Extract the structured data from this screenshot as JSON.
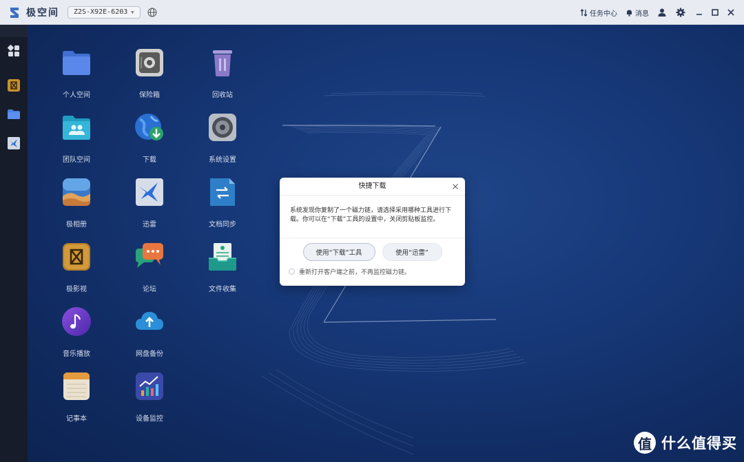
{
  "titlebar": {
    "brand": "极空间",
    "device": "Z2S-X92E-6203",
    "task_center": "任务中心",
    "messages": "消息"
  },
  "apps": [
    {
      "label": "个人空间",
      "icon": "folder-icon"
    },
    {
      "label": "保险箱",
      "icon": "safe-icon"
    },
    {
      "label": "回收站",
      "icon": "trash-icon"
    },
    {
      "label": "团队空间",
      "icon": "team-folder-icon"
    },
    {
      "label": "下载",
      "icon": "download-icon"
    },
    {
      "label": "系统设置",
      "icon": "settings-icon"
    },
    {
      "label": "极相册",
      "icon": "photo-album-icon"
    },
    {
      "label": "迅雷",
      "icon": "thunder-icon"
    },
    {
      "label": "文档同步",
      "icon": "doc-sync-icon"
    },
    {
      "label": "极影视",
      "icon": "video-icon"
    },
    {
      "label": "论坛",
      "icon": "forum-icon"
    },
    {
      "label": "文件收集",
      "icon": "file-collect-icon"
    },
    {
      "label": "音乐播放",
      "icon": "music-icon"
    },
    {
      "label": "网盘备份",
      "icon": "cloud-backup-icon"
    },
    {
      "label": "记事本",
      "icon": "notepad-icon"
    },
    {
      "label": "设备监控",
      "icon": "monitor-icon"
    }
  ],
  "dialog": {
    "title": "快捷下载",
    "message": "系统发现你复制了一个磁力链，请选择采用哪种工具进行下载。你可以在“下载”工具的设置中，关闭剪贴板监控。",
    "btn_download": "使用“下载”工具",
    "btn_thunder": "使用“迅雷”",
    "checkbox_label": "重新打开客户端之前，不再监控磁力链。"
  },
  "watermark": {
    "glyph": "值",
    "text": "什么值得买"
  },
  "colors": {
    "desktop_bg": "#17397a",
    "titlebar_bg": "#e8ecf2",
    "sidebar_bg": "#161c29"
  }
}
